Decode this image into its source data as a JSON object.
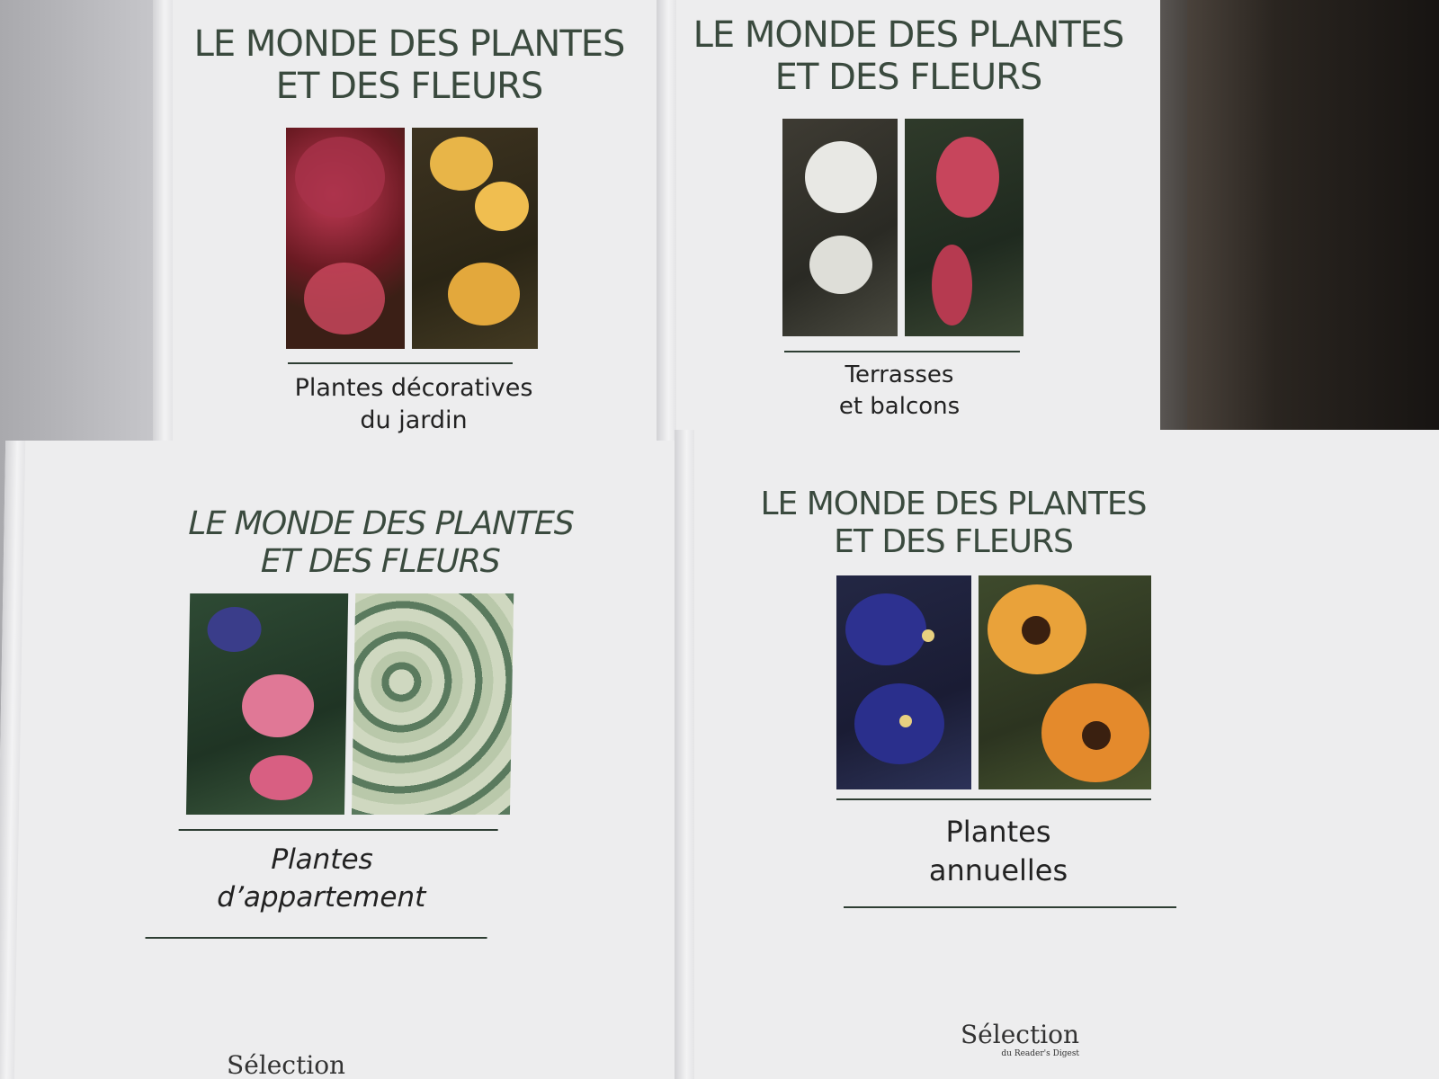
{
  "books": [
    {
      "title": "LE MONDE DES PLANTES\nET DES FLEURS",
      "subtitle": "Plantes décoratives\ndu jardin",
      "publisher": ""
    },
    {
      "title": "LE MONDE DES PLANTES\nET DES FLEURS",
      "subtitle": "Terrasses\net balcons",
      "publisher": ""
    },
    {
      "title": "LE MONDE DES PLANTES\nET DES FLEURS",
      "subtitle": "Plantes\nd’appartement",
      "publisher": "Sélection"
    },
    {
      "title": "LE MONDE DES PLANTES\nET DES FLEURS",
      "subtitle": "Plantes\nannuelles",
      "publisher": "Sélection",
      "publisher_sub": "du Reader's Digest"
    }
  ],
  "icons": {
    "book1_left": "red-begonia-photo",
    "book1_right": "yellow-flowers-photo",
    "book2_left": "white-caper-flower-photo",
    "book2_right": "fuchsia-photo",
    "book3_left": "african-violet-photo",
    "book3_right": "variegated-leaves-photo",
    "book4_left": "purple-pansy-photo",
    "book4_right": "rudbeckia-photo"
  },
  "colors": {
    "title": "#3a4a3e",
    "cover": "#ededee",
    "rule": "#2e3e33"
  }
}
